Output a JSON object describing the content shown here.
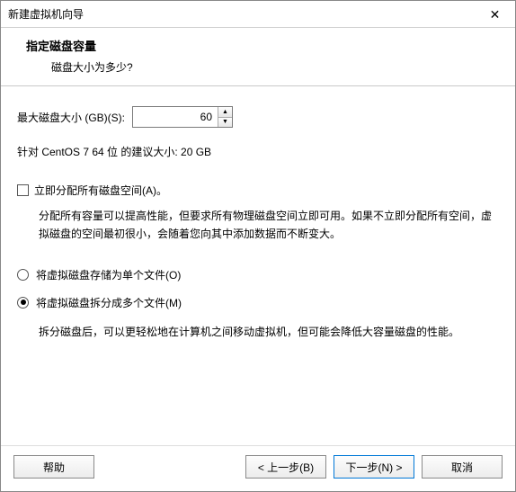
{
  "window": {
    "title": "新建虚拟机向导"
  },
  "header": {
    "title": "指定磁盘容量",
    "subtitle": "磁盘大小为多少?"
  },
  "size": {
    "label": "最大磁盘大小 (GB)(S):",
    "value": "60"
  },
  "recommend": "针对 CentOS 7 64 位 的建议大小: 20 GB",
  "allocate": {
    "label": "立即分配所有磁盘空间(A)。",
    "desc": "分配所有容量可以提高性能，但要求所有物理磁盘空间立即可用。如果不立即分配所有空间，虚拟磁盘的空间最初很小，会随着您向其中添加数据而不断变大。"
  },
  "store": {
    "single": "将虚拟磁盘存储为单个文件(O)",
    "split": "将虚拟磁盘拆分成多个文件(M)",
    "split_desc": "拆分磁盘后，可以更轻松地在计算机之间移动虚拟机，但可能会降低大容量磁盘的性能。"
  },
  "buttons": {
    "help": "帮助",
    "back": "< 上一步(B)",
    "next": "下一步(N) >",
    "cancel": "取消"
  }
}
